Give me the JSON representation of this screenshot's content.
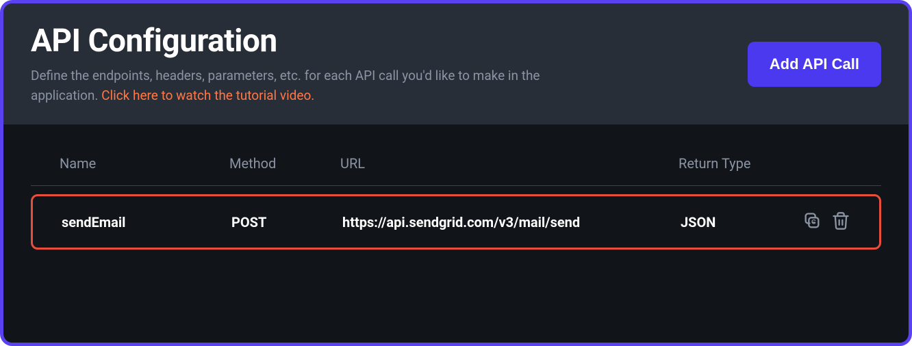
{
  "header": {
    "title": "API Configuration",
    "subtitle_part1": "Define the endpoints, headers, parameters, etc. for each API call you'd like to make in the application. ",
    "tutorial_link_text": "Click here to watch the tutorial video.",
    "add_button_label": "Add API Call"
  },
  "table": {
    "columns": {
      "name": "Name",
      "method": "Method",
      "url": "URL",
      "return_type": "Return Type"
    },
    "rows": [
      {
        "name": "sendEmail",
        "method": "POST",
        "url": "https://api.sendgrid.com/v3/mail/send",
        "return_type": "JSON"
      }
    ]
  },
  "colors": {
    "accent": "#4B39EF",
    "border": "#5A42F0",
    "highlight": "#E94E3C",
    "link": "#FF7847"
  }
}
